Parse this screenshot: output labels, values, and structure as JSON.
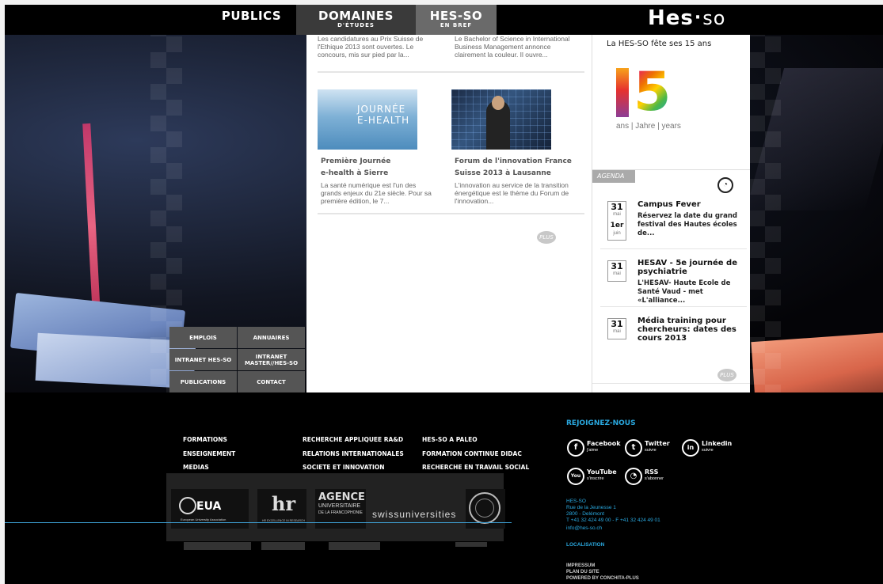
{
  "nav": {
    "publics": "PUBLICS",
    "domaines": "DOMAINES",
    "domaines_sub": "D'ÉTUDES",
    "hesso": "HES-SO",
    "hesso_sub": "EN BREF"
  },
  "logo": {
    "hes": "Hes",
    "dot": "·",
    "so": "so"
  },
  "news": {
    "top_left": "Les candidatures au Prix Suisse de l'Ethique 2013 sont ouvertes. Le concours, mis sur pied par la...",
    "top_right": "Le Bachelor of Science in International Business Management annonce clairement la couleur. Il ouvre...",
    "image1_text": "JOURNÉE\nE-HEALTH",
    "item1_title_l1": "Première Journée",
    "item1_title_l2": "e-health à Sierre",
    "item1_text": "La santé numérique est l'un des grands enjeux du 21e siècle. Pour sa première édition, le 7...",
    "item2_title_l1": "Forum de l'innovation France",
    "item2_title_l2": "Suisse 2013 à Lausanne",
    "item2_text": "L'innovation au service de la transition énergétique est le thème du Forum de l'innovation...",
    "plus": "PLUS"
  },
  "sidebar": {
    "title": "La HES-SO fête ses 15 ans",
    "years_text": "ans | Jahre | years",
    "agenda_label": "AGENDA",
    "events": [
      {
        "day": "31",
        "month": "mai",
        "day2": "1er",
        "month2": "juin",
        "title": "Campus Fever",
        "text": "Réservez la date du grand festival des Hautes écoles de..."
      },
      {
        "day": "31",
        "month": "mai",
        "title": "HESAV - 5e journée de psychiatrie",
        "text": "L'HESAV- Haute Ecole de Santé Vaud - met «L'alliance..."
      },
      {
        "day": "31",
        "month": "mai",
        "title": "Média training pour chercheurs: dates des cours 2013",
        "text": ""
      }
    ],
    "plus": "PLUS"
  },
  "quicklinks": [
    "EMPLOIS",
    "ANNUAIRES",
    "INTRANET HES-SO",
    "INTRANET MASTER//HES-SO",
    "PUBLICATIONS",
    "CONTACT"
  ],
  "footer": {
    "col1": [
      "FORMATIONS",
      "ENSEIGNEMENT",
      "MEDIAS"
    ],
    "col2": [
      "RECHERCHE APPLIQUEE RA&D",
      "RELATIONS INTERNATIONALES",
      "SOCIETE ET INNOVATION"
    ],
    "col3": [
      "HES-SO A PALEO",
      "FORMATION CONTINUE DIDAC",
      "RECHERCHE EN TRAVAIL SOCIAL"
    ],
    "logos": {
      "eua": "EUA",
      "eua_sub": "European University Association",
      "hr": "hr",
      "hr_sub": "HR EXCELLENCE IN RESEARCH",
      "auf_l1": "AGENCE",
      "auf_l2": "UNIVERSITAIRE",
      "auf_l3": "DE LA FRANCOPHONIE",
      "swiss": "swissuniversities"
    },
    "rejoignez": "REJOIGNEZ-NOUS",
    "social": [
      {
        "name": "Facebook",
        "sub": "j'aime",
        "icon": "f"
      },
      {
        "name": "Twitter",
        "sub": "suivre",
        "icon": "t"
      },
      {
        "name": "Linkedin",
        "sub": "suivre",
        "icon": "in"
      },
      {
        "name": "YouTube",
        "sub": "s'inscrire",
        "icon": "You"
      },
      {
        "name": "RSS",
        "sub": "s'abonner",
        "icon": "rss"
      }
    ],
    "address": [
      "HES-SO",
      "Rue de la Jeunesse 1",
      "2800 - Delémont",
      "T +41 32 424 49 00 - F +41 32 424 49 01",
      "info@hes-so.ch"
    ],
    "localisation": "LOCALISATION",
    "lower": [
      "IMPRESSUM",
      "PLAN DU SITE",
      "POWERED BY CONCHITA-PLUS"
    ]
  },
  "colors": {
    "accent": "#2aa9e0",
    "nav_active": "#3a3a3a",
    "nav_hesso": "#6a6a6a"
  }
}
